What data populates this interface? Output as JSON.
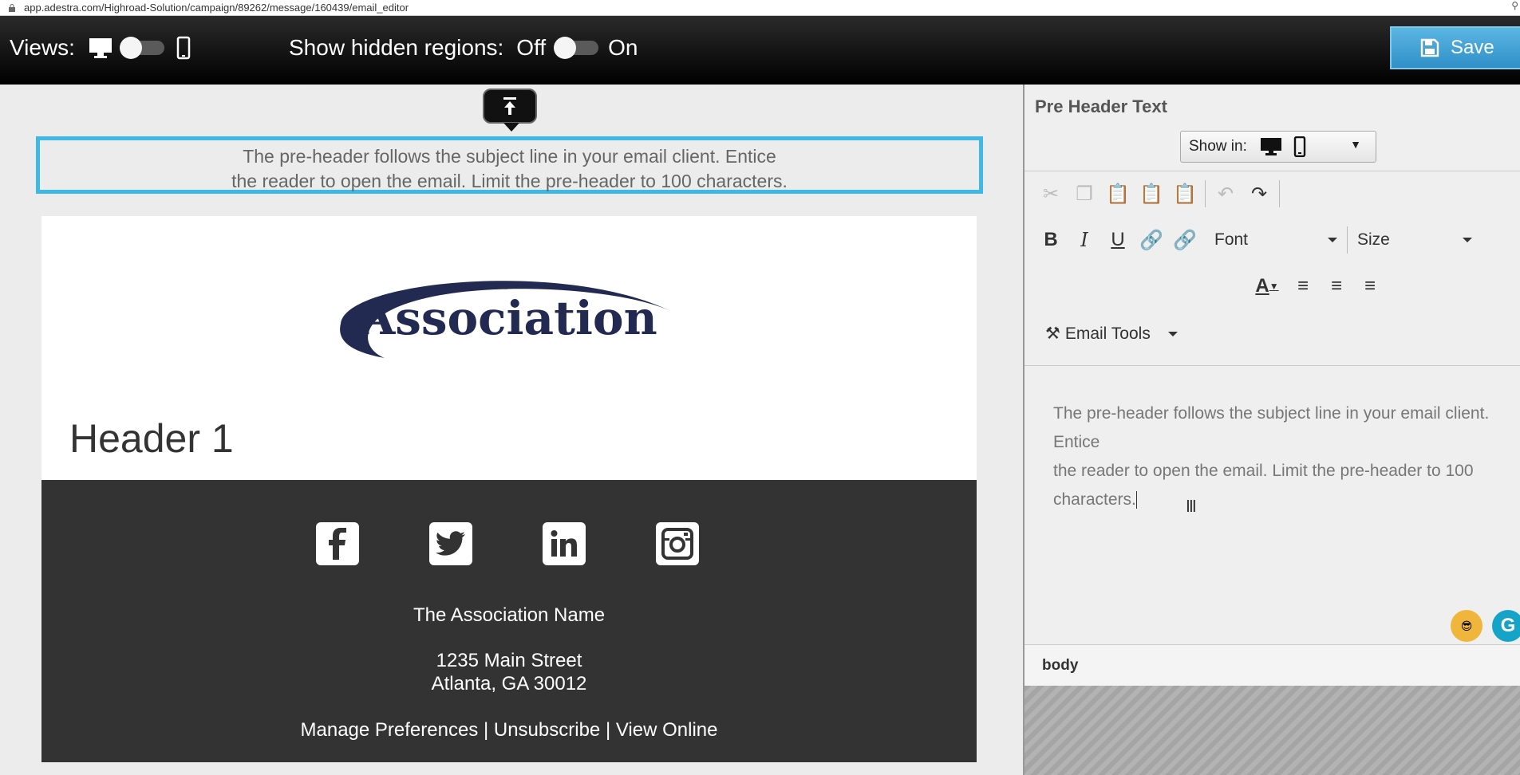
{
  "browser": {
    "url": "app.adestra.com/Highroad-Solution/campaign/89262/message/160439/email_editor"
  },
  "toolbar": {
    "views_label": "Views:",
    "hidden_regions_label": "Show hidden regions:",
    "off_label": "Off",
    "on_label": "On",
    "save_label": "Save",
    "accent_color": "#3fb8e6"
  },
  "canvas": {
    "preheader_line1": "The pre-header follows the subject line in your email client. Entice",
    "preheader_line2": "the reader to open the email. Limit the pre-header to 100 characters.",
    "logo_text": "Association",
    "header1": "Header 1",
    "footer": {
      "org_name": "The Association Name",
      "address_line1": "1235 Main Street",
      "address_line2": "Atlanta, GA 30012",
      "manage_prefs": "Manage Preferences",
      "unsubscribe": "Unsubscribe",
      "view_online": "View Online",
      "separator": "|",
      "socials": [
        "facebook-icon",
        "twitter-icon",
        "linkedin-icon",
        "instagram-icon"
      ]
    }
  },
  "panel": {
    "title": "Pre Header Text",
    "show_in_label": "Show in:",
    "font_combo": "Font",
    "size_combo": "Size",
    "email_tools": "Email Tools",
    "editor_line1": "The pre-header follows the subject line in your email client. Entice",
    "editor_line2": "the reader to open the email. Limit the pre-header to 100 characters.",
    "status_path": "body",
    "bold": "B",
    "italic": "I",
    "underline": "U",
    "font_color": "A",
    "grammarly": "G"
  }
}
